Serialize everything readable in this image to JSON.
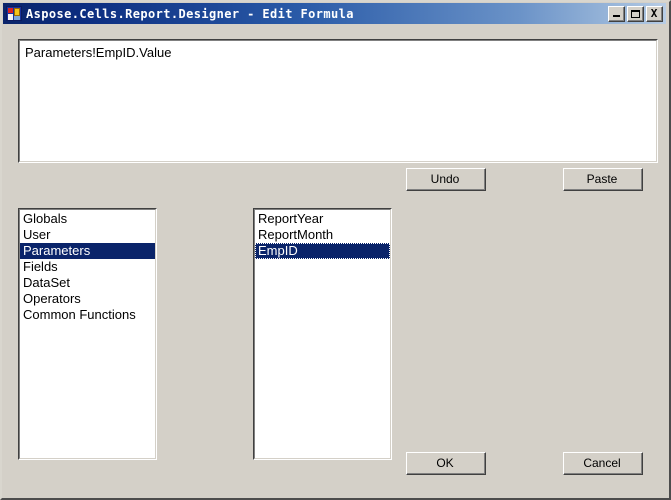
{
  "window": {
    "title": "Aspose.Cells.Report.Designer - Edit Formula",
    "icon": "spreadsheet-icon",
    "controls": {
      "minimize_label": "_",
      "maximize_label": "□",
      "close_label": "X"
    }
  },
  "formula": {
    "value": "Parameters!EmpID.Value",
    "placeholder": ""
  },
  "buttons": {
    "undo": "Undo",
    "paste": "Paste",
    "ok": "OK",
    "cancel": "Cancel"
  },
  "categories": {
    "selected": "Parameters",
    "items": [
      {
        "label": "Globals",
        "selected": false
      },
      {
        "label": "User",
        "selected": false
      },
      {
        "label": "Parameters",
        "selected": true
      },
      {
        "label": "Fields",
        "selected": false
      },
      {
        "label": "DataSet",
        "selected": false
      },
      {
        "label": "Operators",
        "selected": false
      },
      {
        "label": "Common Functions",
        "selected": false
      }
    ]
  },
  "items": {
    "selected": "EmpID",
    "entries": [
      {
        "label": "ReportYear",
        "selected": false
      },
      {
        "label": "ReportMonth",
        "selected": false
      },
      {
        "label": "EmpID",
        "selected": true
      }
    ]
  },
  "colors": {
    "face": "#d4d0c8",
    "selection": "#0a246a",
    "selection_text": "#ffffff",
    "titlebar_start": "#0a246a",
    "titlebar_end": "#b8cde6",
    "field_bg": "#ffffff"
  }
}
